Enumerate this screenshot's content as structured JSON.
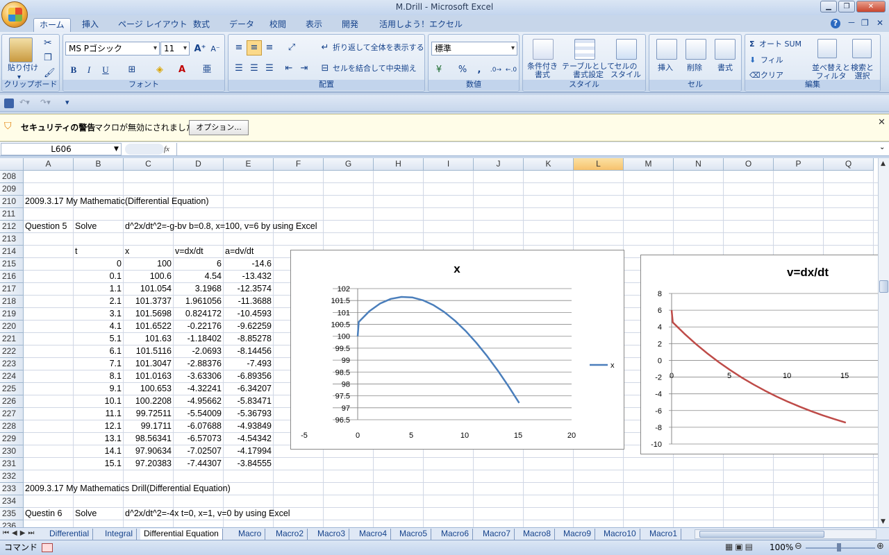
{
  "window": {
    "title": "M.Drill - Microsoft Excel"
  },
  "ribbon_tabs": [
    "ホーム",
    "挿入",
    "ページ レイアウト",
    "数式",
    "データ",
    "校閲",
    "表示",
    "開発",
    "活用しよう！エクセル"
  ],
  "ribbon": {
    "clipboard": {
      "paste": "貼り付け",
      "label": "クリップボード"
    },
    "font": {
      "name": "MS Pゴシック",
      "size": "11",
      "label": "フォント",
      "bold": "B",
      "italic": "I",
      "underline": "U"
    },
    "alignment": {
      "wrap": "折り返して全体を表示する",
      "merge": "セルを結合して中央揃え",
      "label": "配置"
    },
    "number": {
      "format": "標準",
      "label": "数値",
      "percent": "%",
      "comma": ","
    },
    "styles": {
      "conditional": "条件付き\n書式",
      "table": "テーブルとして\n書式設定",
      "cell": "セルの\nスタイル",
      "label": "スタイル"
    },
    "cells": {
      "insert": "挿入",
      "delete": "削除",
      "format": "書式",
      "label": "セル"
    },
    "editing": {
      "autosum": "オート SUM",
      "fill": "フィル",
      "clear": "クリア",
      "sort": "並べ替えと\nフィルタ",
      "find": "検索と\n選択",
      "label": "編集"
    }
  },
  "security": {
    "title": "セキュリティの警告",
    "message": "マクロが無効にされました。",
    "options": "オプション..."
  },
  "formula_bar": {
    "name_box": "L606",
    "fx": "fx",
    "formula": ""
  },
  "columns": [
    "A",
    "B",
    "C",
    "D",
    "E",
    "F",
    "G",
    "H",
    "I",
    "J",
    "K",
    "L",
    "M",
    "N",
    "O",
    "P",
    "Q"
  ],
  "selected_column": "L",
  "rows": [
    {
      "n": "208",
      "cells": []
    },
    {
      "n": "209",
      "cells": []
    },
    {
      "n": "210",
      "cells": [
        {
          "c": "A",
          "v": "2009.3.17  My Mathematic(Differential Equation)"
        }
      ]
    },
    {
      "n": "211",
      "cells": []
    },
    {
      "n": "212",
      "cells": [
        {
          "c": "A",
          "v": "Question 5"
        },
        {
          "c": "B",
          "v": "Solve"
        },
        {
          "c": "C",
          "v": "d^2x/dt^2=-g-bv   b=0.8, x=100, v=6    by using Excel"
        }
      ]
    },
    {
      "n": "213",
      "cells": []
    },
    {
      "n": "214",
      "cells": [
        {
          "c": "B",
          "v": "t"
        },
        {
          "c": "C",
          "v": "x"
        },
        {
          "c": "D",
          "v": "v=dx/dt"
        },
        {
          "c": "E",
          "v": "a=dv/dt"
        }
      ]
    },
    {
      "n": "215",
      "cells": [
        {
          "c": "B",
          "v": "0",
          "num": true
        },
        {
          "c": "C",
          "v": "100",
          "num": true
        },
        {
          "c": "D",
          "v": "6",
          "num": true
        },
        {
          "c": "E",
          "v": "-14.6",
          "num": true
        }
      ]
    },
    {
      "n": "216",
      "cells": [
        {
          "c": "B",
          "v": "0.1",
          "num": true
        },
        {
          "c": "C",
          "v": "100.6",
          "num": true
        },
        {
          "c": "D",
          "v": "4.54",
          "num": true
        },
        {
          "c": "E",
          "v": "-13.432",
          "num": true
        }
      ]
    },
    {
      "n": "217",
      "cells": [
        {
          "c": "B",
          "v": "1.1",
          "num": true
        },
        {
          "c": "C",
          "v": "101.054",
          "num": true
        },
        {
          "c": "D",
          "v": "3.1968",
          "num": true
        },
        {
          "c": "E",
          "v": "-12.3574",
          "num": true
        }
      ]
    },
    {
      "n": "218",
      "cells": [
        {
          "c": "B",
          "v": "2.1",
          "num": true
        },
        {
          "c": "C",
          "v": "101.3737",
          "num": true
        },
        {
          "c": "D",
          "v": "1.961056",
          "num": true
        },
        {
          "c": "E",
          "v": "-11.3688",
          "num": true
        }
      ]
    },
    {
      "n": "219",
      "cells": [
        {
          "c": "B",
          "v": "3.1",
          "num": true
        },
        {
          "c": "C",
          "v": "101.5698",
          "num": true
        },
        {
          "c": "D",
          "v": "0.824172",
          "num": true
        },
        {
          "c": "E",
          "v": "-10.4593",
          "num": true
        }
      ]
    },
    {
      "n": "220",
      "cells": [
        {
          "c": "B",
          "v": "4.1",
          "num": true
        },
        {
          "c": "C",
          "v": "101.6522",
          "num": true
        },
        {
          "c": "D",
          "v": "-0.22176",
          "num": true
        },
        {
          "c": "E",
          "v": "-9.62259",
          "num": true
        }
      ]
    },
    {
      "n": "221",
      "cells": [
        {
          "c": "B",
          "v": "5.1",
          "num": true
        },
        {
          "c": "C",
          "v": "101.63",
          "num": true
        },
        {
          "c": "D",
          "v": "-1.18402",
          "num": true
        },
        {
          "c": "E",
          "v": "-8.85278",
          "num": true
        }
      ]
    },
    {
      "n": "222",
      "cells": [
        {
          "c": "B",
          "v": "6.1",
          "num": true
        },
        {
          "c": "C",
          "v": "101.5116",
          "num": true
        },
        {
          "c": "D",
          "v": "-2.0693",
          "num": true
        },
        {
          "c": "E",
          "v": "-8.14456",
          "num": true
        }
      ]
    },
    {
      "n": "223",
      "cells": [
        {
          "c": "B",
          "v": "7.1",
          "num": true
        },
        {
          "c": "C",
          "v": "101.3047",
          "num": true
        },
        {
          "c": "D",
          "v": "-2.88376",
          "num": true
        },
        {
          "c": "E",
          "v": "-7.493",
          "num": true
        }
      ]
    },
    {
      "n": "224",
      "cells": [
        {
          "c": "B",
          "v": "8.1",
          "num": true
        },
        {
          "c": "C",
          "v": "101.0163",
          "num": true
        },
        {
          "c": "D",
          "v": "-3.63306",
          "num": true
        },
        {
          "c": "E",
          "v": "-6.89356",
          "num": true
        }
      ]
    },
    {
      "n": "225",
      "cells": [
        {
          "c": "B",
          "v": "9.1",
          "num": true
        },
        {
          "c": "C",
          "v": "100.653",
          "num": true
        },
        {
          "c": "D",
          "v": "-4.32241",
          "num": true
        },
        {
          "c": "E",
          "v": "-6.34207",
          "num": true
        }
      ]
    },
    {
      "n": "226",
      "cells": [
        {
          "c": "B",
          "v": "10.1",
          "num": true
        },
        {
          "c": "C",
          "v": "100.2208",
          "num": true
        },
        {
          "c": "D",
          "v": "-4.95662",
          "num": true
        },
        {
          "c": "E",
          "v": "-5.83471",
          "num": true
        }
      ]
    },
    {
      "n": "227",
      "cells": [
        {
          "c": "B",
          "v": "11.1",
          "num": true
        },
        {
          "c": "C",
          "v": "99.72511",
          "num": true
        },
        {
          "c": "D",
          "v": "-5.54009",
          "num": true
        },
        {
          "c": "E",
          "v": "-5.36793",
          "num": true
        }
      ]
    },
    {
      "n": "228",
      "cells": [
        {
          "c": "B",
          "v": "12.1",
          "num": true
        },
        {
          "c": "C",
          "v": "99.1711",
          "num": true
        },
        {
          "c": "D",
          "v": "-6.07688",
          "num": true
        },
        {
          "c": "E",
          "v": "-4.93849",
          "num": true
        }
      ]
    },
    {
      "n": "229",
      "cells": [
        {
          "c": "B",
          "v": "13.1",
          "num": true
        },
        {
          "c": "C",
          "v": "98.56341",
          "num": true
        },
        {
          "c": "D",
          "v": "-6.57073",
          "num": true
        },
        {
          "c": "E",
          "v": "-4.54342",
          "num": true
        }
      ]
    },
    {
      "n": "230",
      "cells": [
        {
          "c": "B",
          "v": "14.1",
          "num": true
        },
        {
          "c": "C",
          "v": "97.90634",
          "num": true
        },
        {
          "c": "D",
          "v": "-7.02507",
          "num": true
        },
        {
          "c": "E",
          "v": "-4.17994",
          "num": true
        }
      ]
    },
    {
      "n": "231",
      "cells": [
        {
          "c": "B",
          "v": "15.1",
          "num": true
        },
        {
          "c": "C",
          "v": "97.20383",
          "num": true
        },
        {
          "c": "D",
          "v": "-7.44307",
          "num": true
        },
        {
          "c": "E",
          "v": "-3.84555",
          "num": true
        }
      ]
    },
    {
      "n": "232",
      "cells": []
    },
    {
      "n": "233",
      "cells": [
        {
          "c": "A",
          "v": "2009.3.17  My Mathematics Drill(Differential Equation)"
        }
      ]
    },
    {
      "n": "234",
      "cells": []
    },
    {
      "n": "235",
      "cells": [
        {
          "c": "A",
          "v": "Questin 6"
        },
        {
          "c": "B",
          "v": "Solve"
        },
        {
          "c": "C",
          "v": "d^2x/dt^2=-4x   t=0, x=1, v=0   by using Excel"
        }
      ]
    },
    {
      "n": "236",
      "cells": []
    }
  ],
  "chart_data": [
    {
      "type": "line",
      "title": "x",
      "x": [
        0,
        0.1,
        1.1,
        2.1,
        3.1,
        4.1,
        5.1,
        6.1,
        7.1,
        8.1,
        9.1,
        10.1,
        11.1,
        12.1,
        13.1,
        14.1,
        15.1
      ],
      "series": [
        {
          "name": "x",
          "values": [
            100,
            100.6,
            101.054,
            101.3737,
            101.5698,
            101.6522,
            101.63,
            101.5116,
            101.3047,
            101.0163,
            100.653,
            100.2208,
            99.72511,
            99.1711,
            98.56341,
            97.90634,
            97.20383
          ],
          "color": "#4a7ebb"
        }
      ],
      "xlim": [
        -5,
        20
      ],
      "ylim": [
        96.5,
        102
      ],
      "xticks": [
        "-5",
        "0",
        "5",
        "10",
        "15",
        "20"
      ],
      "yticks": [
        "96.5",
        "97",
        "97.5",
        "98",
        "98.5",
        "99",
        "99.5",
        "100",
        "100.5",
        "101",
        "101.5",
        "102"
      ],
      "grid": true,
      "legend": "right"
    },
    {
      "type": "line",
      "title": "v=dx/dt",
      "x": [
        0,
        0.1,
        1.1,
        2.1,
        3.1,
        4.1,
        5.1,
        6.1,
        7.1,
        8.1,
        9.1,
        10.1,
        11.1,
        12.1,
        13.1,
        14.1,
        15.1
      ],
      "series": [
        {
          "values": [
            6,
            4.54,
            3.1968,
            1.961056,
            0.824172,
            -0.22176,
            -1.18402,
            -2.0693,
            -2.88376,
            -3.63306,
            -4.32241,
            -4.95662,
            -5.54009,
            -6.07688,
            -6.57073,
            -7.02507,
            -7.44307
          ],
          "color": "#be4b48"
        }
      ],
      "xlim": [
        0,
        18
      ],
      "ylim": [
        -10,
        8
      ],
      "xticks": [
        "0",
        "5",
        "10",
        "15"
      ],
      "yticks": [
        "-10",
        "-8",
        "-6",
        "-4",
        "-2",
        "0",
        "2",
        "4",
        "6",
        "8"
      ],
      "grid": true
    }
  ],
  "sheet_tabs": [
    "Differential",
    "Integral",
    "Differential Equation",
    "Macro",
    "Macro2",
    "Macro3",
    "Macro4",
    "Macro5",
    "Macro6",
    "Macro7",
    "Macro8",
    "Macro9",
    "Macro10",
    "Macro1"
  ],
  "active_sheet": "Differential Equation",
  "status": {
    "mode": "コマンド",
    "zoom": "100%"
  }
}
